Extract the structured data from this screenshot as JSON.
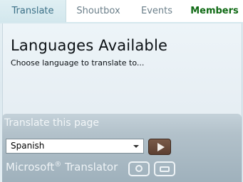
{
  "tabs": [
    {
      "label": "Translate",
      "active": true
    },
    {
      "label": "Shoutbox",
      "active": false
    },
    {
      "label": "Events",
      "active": false
    },
    {
      "label": "Members",
      "active": false
    }
  ],
  "main": {
    "title": "Languages Available",
    "subtitle": "Choose language to translate to..."
  },
  "translator": {
    "title": "Translate this page",
    "selected_language": "Spanish",
    "go_icon": "play-icon",
    "brand": "Microsoft",
    "brand_reg": "®",
    "brand_suffix": " Translator",
    "share_icon": "share-icon",
    "embed_icon": "embed-icon"
  },
  "colors": {
    "active_tab_text": "#3a6f86",
    "members_tab_text": "#0f6a14",
    "go_button": "#5c3f31"
  }
}
